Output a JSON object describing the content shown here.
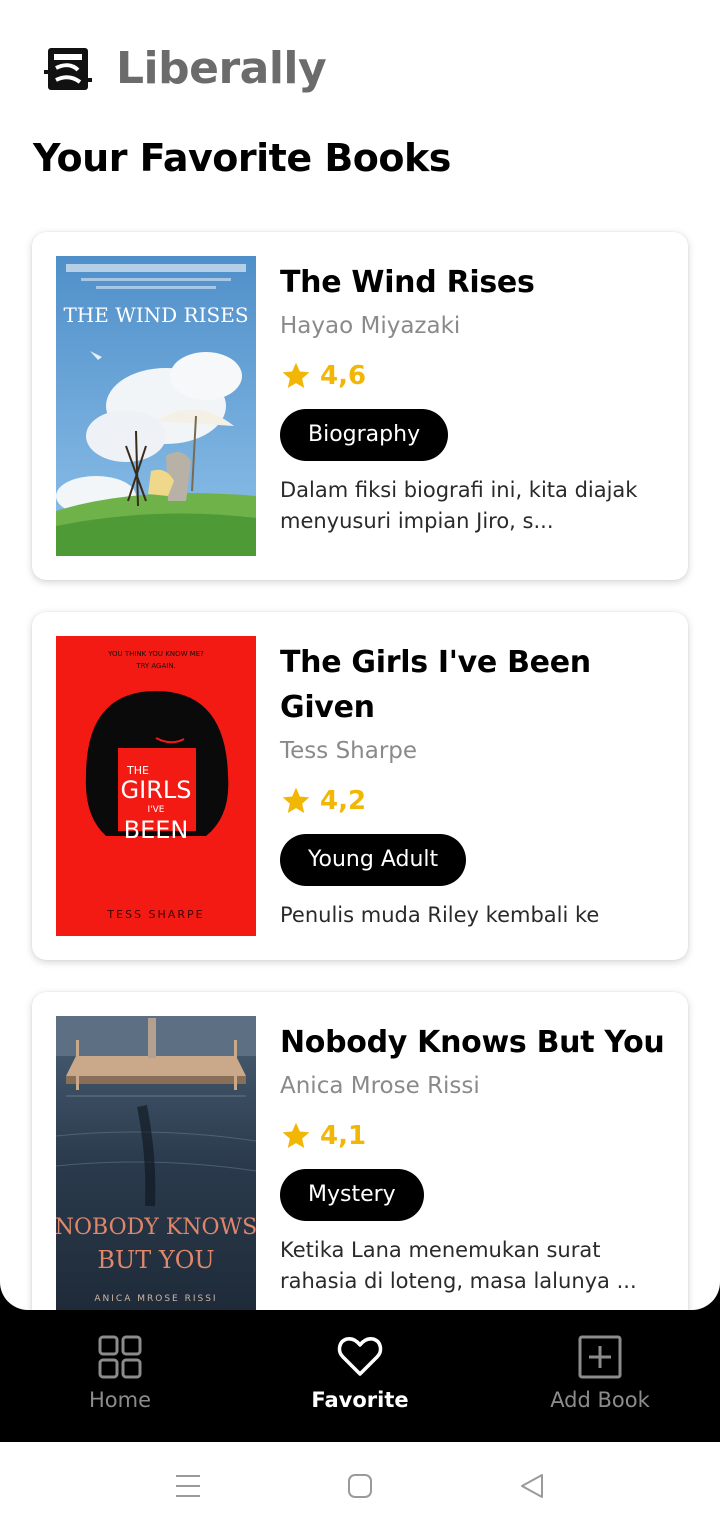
{
  "app": {
    "brand": "Liberally",
    "page_title": "Your Favorite Books"
  },
  "books": [
    {
      "title": "The Wind Rises",
      "author": "Hayao Miyazaki",
      "rating": "4,6",
      "genre": "Biography",
      "description": "Dalam fiksi biografi ini, kita diajak menyusuri impian Jiro, s...",
      "cover": {
        "title": "THE WIND RISES",
        "bg": "#5c98cf"
      }
    },
    {
      "title": "The Girls I've Been Given",
      "author": "Tess Sharpe",
      "rating": "4,2",
      "genre": "Young Adult",
      "description": "Penulis muda Riley kembali ke",
      "cover": {
        "tagline_1": "YOU THINK YOU KNOW ME?",
        "tagline_2": "TRY AGAIN.",
        "title_1": "THE",
        "title_2": "GIRLS",
        "title_3": "I'VE",
        "title_4": "BEEN",
        "author": "TESS SHARPE",
        "bg": "#f41a14"
      }
    },
    {
      "title": "Nobody Knows But You",
      "author": "Anica Mrose Rissi",
      "rating": "4,1",
      "genre": "Mystery",
      "description": "Ketika Lana menemukan surat rahasia di loteng, masa lalunya ...",
      "cover": {
        "title_1": "NOBODY KNOWS",
        "title_2": "BUT YOU",
        "author": "ANICA MROSE RISSI",
        "bg": "#2b3a4a"
      }
    }
  ],
  "nav": {
    "items": [
      {
        "label": "Home",
        "icon": "grid-icon"
      },
      {
        "label": "Favorite",
        "icon": "heart-icon"
      },
      {
        "label": "Add Book",
        "icon": "plus-square-icon"
      }
    ],
    "active": "Favorite"
  },
  "colors": {
    "accent_rating": "#f2b705",
    "nav_bg": "#000000",
    "chip_bg": "#000000",
    "author_text": "#8a8a8a"
  }
}
